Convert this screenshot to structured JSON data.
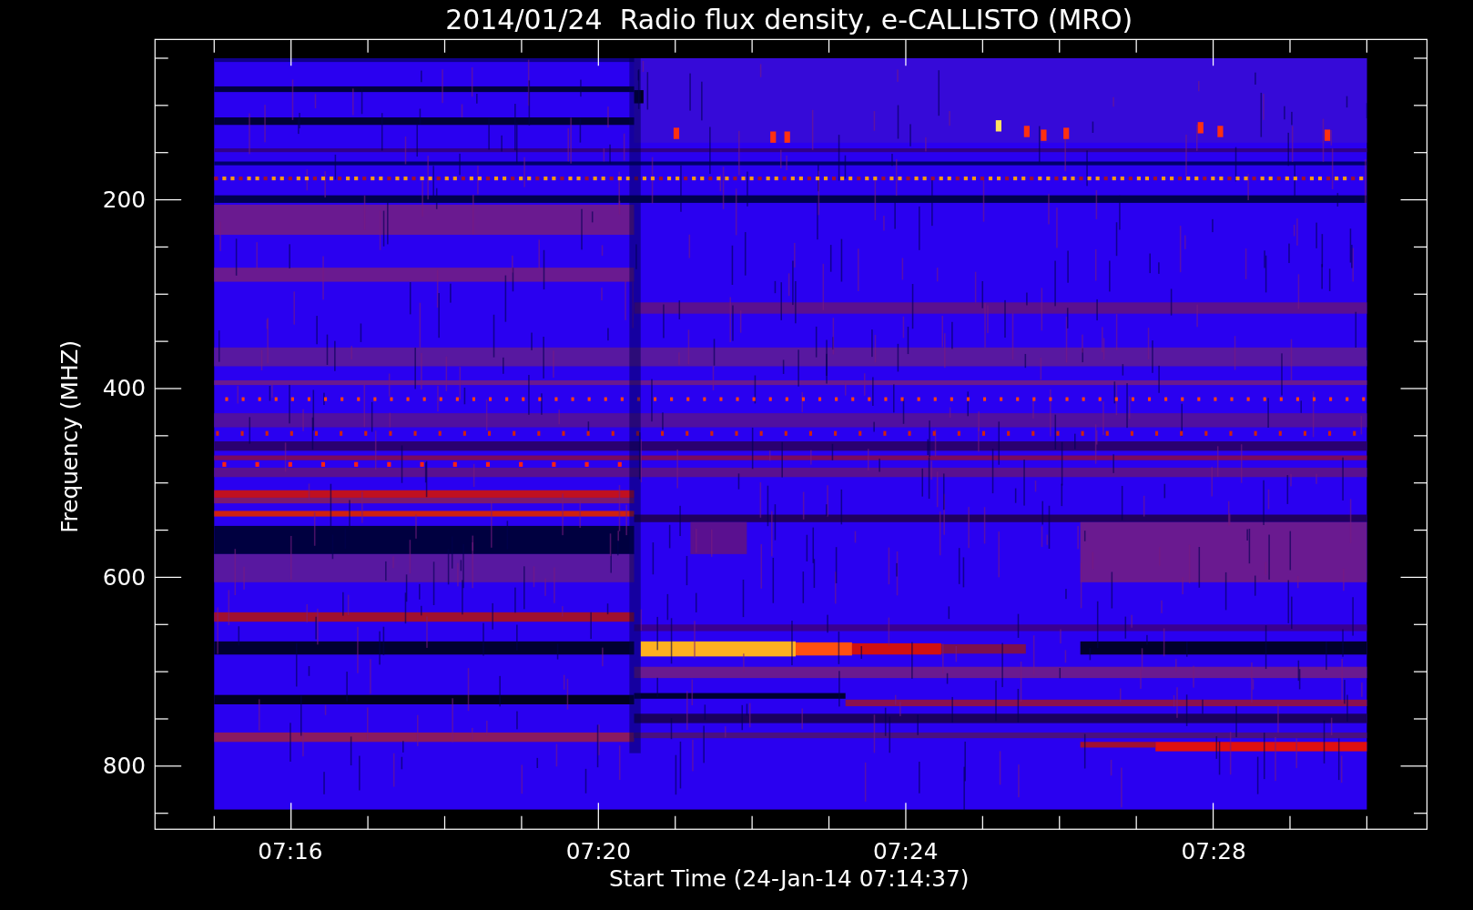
{
  "title": "2014/01/24  Radio flux density, e-CALLISTO (MRO)",
  "y_axis": {
    "label": "Frequency (MHZ)",
    "ticks": [
      "200",
      "400",
      "600",
      "800"
    ]
  },
  "x_axis": {
    "label": "Start Time (24-Jan-14 07:14:37)",
    "ticks": [
      "07:16",
      "07:20",
      "07:24",
      "07:28"
    ]
  }
}
